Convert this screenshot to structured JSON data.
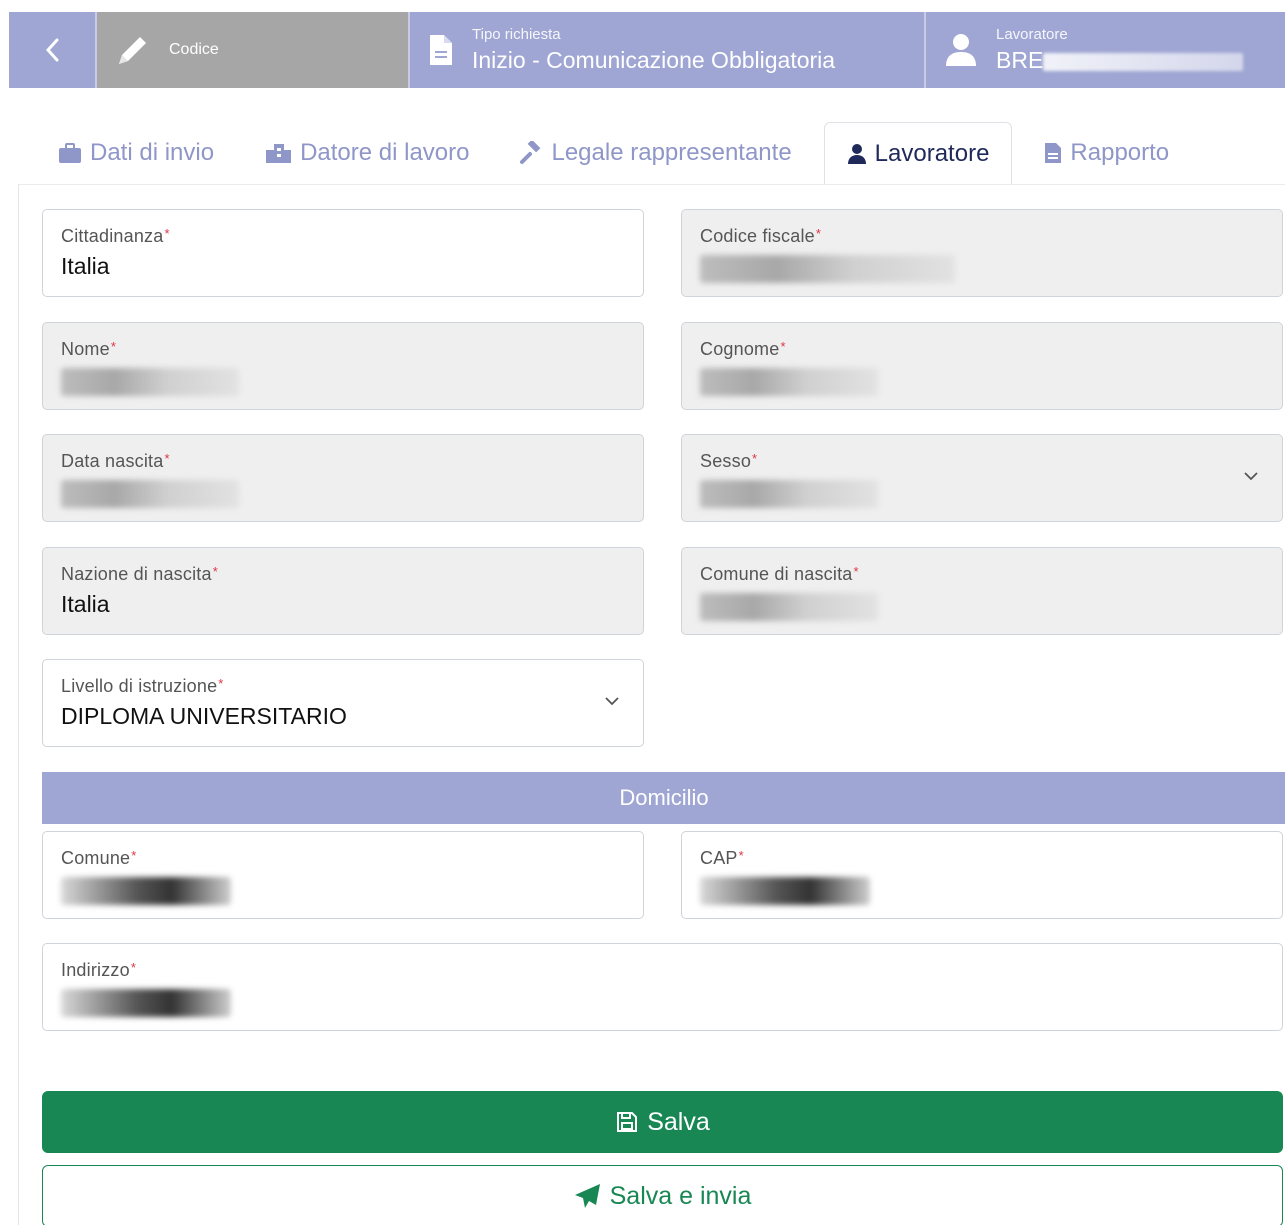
{
  "header": {
    "back_icon": "chevron-left-icon",
    "code": {
      "icon": "pencil-icon",
      "label": "Codice"
    },
    "request_type": {
      "icon": "file-text-icon",
      "label": "Tipo richiesta",
      "value": "Inizio - Comunicazione Obbligatoria"
    },
    "worker": {
      "icon": "user-icon",
      "label": "Lavoratore",
      "value": "BRE"
    }
  },
  "tabs": [
    {
      "label": "Dati di invio",
      "icon": "briefcase-icon",
      "active": false
    },
    {
      "label": "Datore di lavoro",
      "icon": "building-icon",
      "active": false
    },
    {
      "label": "Legale rappresentante",
      "icon": "gavel-icon",
      "active": false
    },
    {
      "label": "Lavoratore",
      "icon": "user-icon",
      "active": true
    },
    {
      "label": "Rapporto",
      "icon": "file-pdf-icon",
      "active": false
    }
  ],
  "form": {
    "cittadinanza": {
      "label": "Cittadinanza",
      "value": "Italia"
    },
    "codice_fiscale": {
      "label": "Codice fiscale",
      "value": ""
    },
    "nome": {
      "label": "Nome",
      "value": ""
    },
    "cognome": {
      "label": "Cognome",
      "value": ""
    },
    "data_nascita": {
      "label": "Data nascita",
      "value": ""
    },
    "sesso": {
      "label": "Sesso",
      "value": ""
    },
    "nazione_nascita": {
      "label": "Nazione di nascita",
      "value": "Italia"
    },
    "comune_nascita": {
      "label": "Comune di nascita",
      "value": ""
    },
    "livello_istruzione": {
      "label": "Livello di istruzione",
      "value": "DIPLOMA UNIVERSITARIO"
    },
    "required_mark": "*"
  },
  "domicilio": {
    "title": "Domicilio",
    "comune": {
      "label": "Comune",
      "value": ""
    },
    "cap": {
      "label": "CAP",
      "value": ""
    },
    "indirizzo": {
      "label": "Indirizzo",
      "value": ""
    }
  },
  "actions": {
    "save": {
      "label": "Salva",
      "icon": "floppy-disk-icon"
    },
    "save_send": {
      "label": "Salva e invia",
      "icon": "paper-plane-icon"
    }
  },
  "colors": {
    "header": "#9fa6d3",
    "header_code": "#a6a6a6",
    "tab_inactive": "#8f96c8",
    "tab_active": "#1f2a5a",
    "required": "#dc3545",
    "save": "#198754"
  }
}
